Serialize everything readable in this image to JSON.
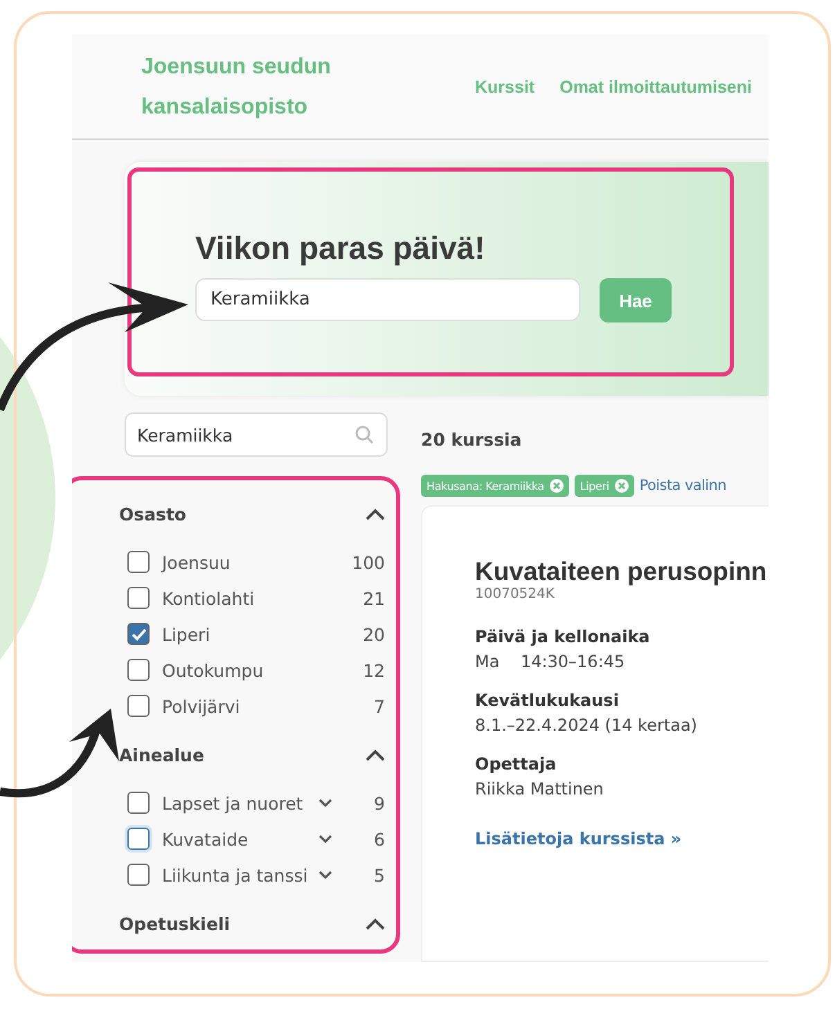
{
  "header": {
    "logo": "Joensuun seudun kansalaisopisto",
    "nav": [
      "Kurssit",
      "Omat ilmoittautumiseni"
    ]
  },
  "hero": {
    "title": "Viikon paras päivä!",
    "search": {
      "value": "Keramiikka"
    },
    "button": "Hae"
  },
  "sidebar": {
    "search": {
      "value": "Keramiikka"
    },
    "groups": [
      {
        "title": "Osasto",
        "expanded": true,
        "items": [
          {
            "label": "Joensuu",
            "count": "100",
            "checked": false,
            "focused": false,
            "has_children": false
          },
          {
            "label": "Kontiolahti",
            "count": "21",
            "checked": false,
            "focused": false,
            "has_children": false
          },
          {
            "label": "Liperi",
            "count": "20",
            "checked": true,
            "focused": false,
            "has_children": false
          },
          {
            "label": "Outokumpu",
            "count": "12",
            "checked": false,
            "focused": false,
            "has_children": false
          },
          {
            "label": "Polvijärvi",
            "count": "7",
            "checked": false,
            "focused": false,
            "has_children": false
          }
        ]
      },
      {
        "title": "Ainealue",
        "expanded": true,
        "items": [
          {
            "label": "Lapset ja nuoret",
            "count": "9",
            "checked": false,
            "focused": false,
            "has_children": true
          },
          {
            "label": "Kuvataide",
            "count": "6",
            "checked": false,
            "focused": true,
            "has_children": true
          },
          {
            "label": "Liikunta ja tanssi",
            "count": "5",
            "checked": false,
            "focused": false,
            "has_children": true
          }
        ]
      },
      {
        "title": "Opetuskieli",
        "expanded": true
      }
    ]
  },
  "results": {
    "count": "20 kurssia",
    "chips": [
      "Hakusana: Keramiikka",
      "Liperi"
    ],
    "clear": "Poista valinn",
    "course": {
      "title": "Kuvataiteen perusopinn",
      "code": "10070524K",
      "fields": [
        {
          "label": "Päivä ja kellonaika",
          "value": "Ma    14:30–16:45"
        },
        {
          "label": "Kevätlukukausi",
          "value": "8.1.–22.4.2024 (14 kertaa)"
        },
        {
          "label": "Opettaja",
          "value": "Riikka Mattinen"
        }
      ],
      "link": "Lisätietoja kurssista »"
    }
  }
}
